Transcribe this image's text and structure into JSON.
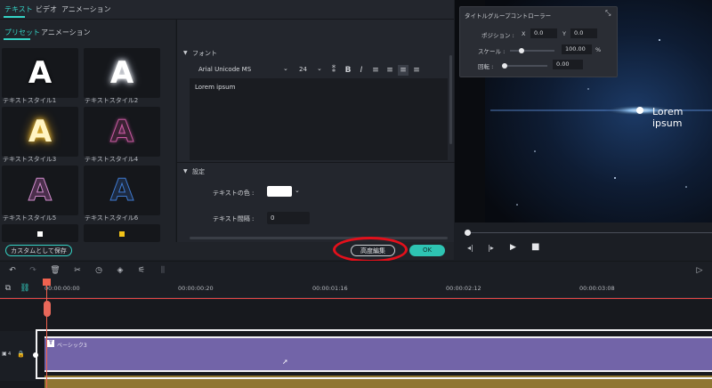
{
  "top_tabs": [
    "テキスト",
    "ビデオ",
    "アニメーション"
  ],
  "sub_tabs": [
    "プリセット",
    "アニメーション"
  ],
  "presets": [
    {
      "label": "テキストスタイル1",
      "glyph": "A"
    },
    {
      "label": "テキストスタイル2",
      "glyph": "A"
    },
    {
      "label": "テキストスタイル3",
      "glyph": "A"
    },
    {
      "label": "テキストスタイル4",
      "glyph": "A"
    },
    {
      "label": "テキストスタイル5",
      "glyph": "A"
    },
    {
      "label": "テキストスタイル6",
      "glyph": "A"
    }
  ],
  "font_section": {
    "title": "フォント",
    "font_family": "Arial Unicode MS",
    "font_size": "24",
    "text": "Lorem ipsum"
  },
  "settings_section": {
    "title": "設定",
    "color_label": "テキストの色 :",
    "spacing_label": "テキスト間隔 :",
    "spacing_value": "0"
  },
  "buttons": {
    "save_custom": "カスタムとして保存",
    "advanced_edit": "高度編集",
    "ok": "OK"
  },
  "controller": {
    "title": "タイトルグループコントローラー",
    "position_label": "ポジション :",
    "x_label": "X",
    "x_value": "0.0",
    "y_label": "Y",
    "y_value": "0.0",
    "scale_label": "スケール :",
    "scale_value": "100.00",
    "scale_unit": "%",
    "rotate_label": "回転 :",
    "rotate_value": "0.00"
  },
  "preview": {
    "overlay_text": "Lorem ipsum"
  },
  "timeline": {
    "ticks": [
      "00:00:00:00",
      "00:00:00:20",
      "00:00:01:16",
      "00:00:02:12",
      "00:00:03:08"
    ],
    "clip_label": "ベーシック3",
    "track_number": "4"
  },
  "colors": {
    "accent": "#34d3c5",
    "highlight_ring": "#e3101b",
    "clip_purple": "#7264a8",
    "playhead": "#f0624f"
  }
}
